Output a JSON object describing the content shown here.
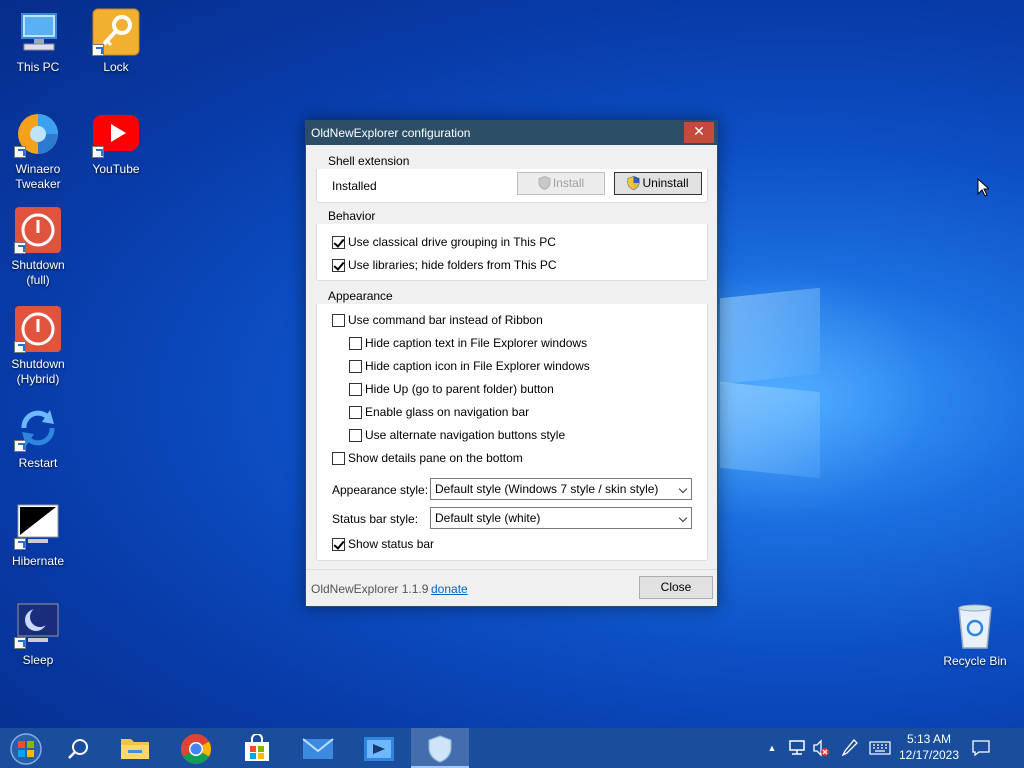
{
  "desktop": {
    "icons": [
      {
        "label": "This PC"
      },
      {
        "label": "Lock"
      },
      {
        "label": "Winaero Tweaker"
      },
      {
        "label": "YouTube"
      },
      {
        "label": "Shutdown (full)"
      },
      {
        "label": "Shutdown (Hybrid)"
      },
      {
        "label": "Restart"
      },
      {
        "label": "Hibernate"
      },
      {
        "label": "Sleep"
      },
      {
        "label": "Recycle Bin"
      }
    ]
  },
  "dialog": {
    "title": "OldNewExplorer configuration",
    "close_glyph": "✕",
    "shell_extension": {
      "title": "Shell extension",
      "status": "Installed",
      "install_label": "Install",
      "uninstall_label": "Uninstall"
    },
    "behavior": {
      "title": "Behavior",
      "options": [
        {
          "label": "Use classical drive grouping in This PC",
          "checked": true
        },
        {
          "label": "Use libraries; hide folders from This PC",
          "checked": true
        }
      ]
    },
    "appearance": {
      "title": "Appearance",
      "command_bar": {
        "label": "Use command bar instead of Ribbon",
        "checked": false
      },
      "sub_options": [
        {
          "label": "Hide caption text in File Explorer windows",
          "checked": false
        },
        {
          "label": "Hide caption icon in File Explorer windows",
          "checked": false
        },
        {
          "label": "Hide Up (go to parent folder) button",
          "checked": false
        },
        {
          "label": "Enable glass on navigation bar",
          "checked": false
        },
        {
          "label": "Use alternate navigation buttons style",
          "checked": false
        }
      ],
      "details_pane": {
        "label": "Show details pane on the bottom",
        "checked": false
      },
      "appearance_style_label": "Appearance style:",
      "appearance_style_value": "Default style (Windows 7 style / skin style)",
      "status_bar_style_label": "Status bar style:",
      "status_bar_style_value": "Default style (white)",
      "show_status_bar": {
        "label": "Show status bar",
        "checked": true
      }
    },
    "footer": {
      "version": "OldNewExplorer 1.1.9",
      "donate": "donate",
      "close_label": "Close"
    }
  },
  "taskbar": {
    "time": "5:13 AM",
    "date": "12/17/2023",
    "tray_chevron": "▲"
  },
  "colors": {
    "titlebar": "#2b4d66",
    "close_button": "#c64a3c",
    "taskbar": "#1a4d9c"
  }
}
